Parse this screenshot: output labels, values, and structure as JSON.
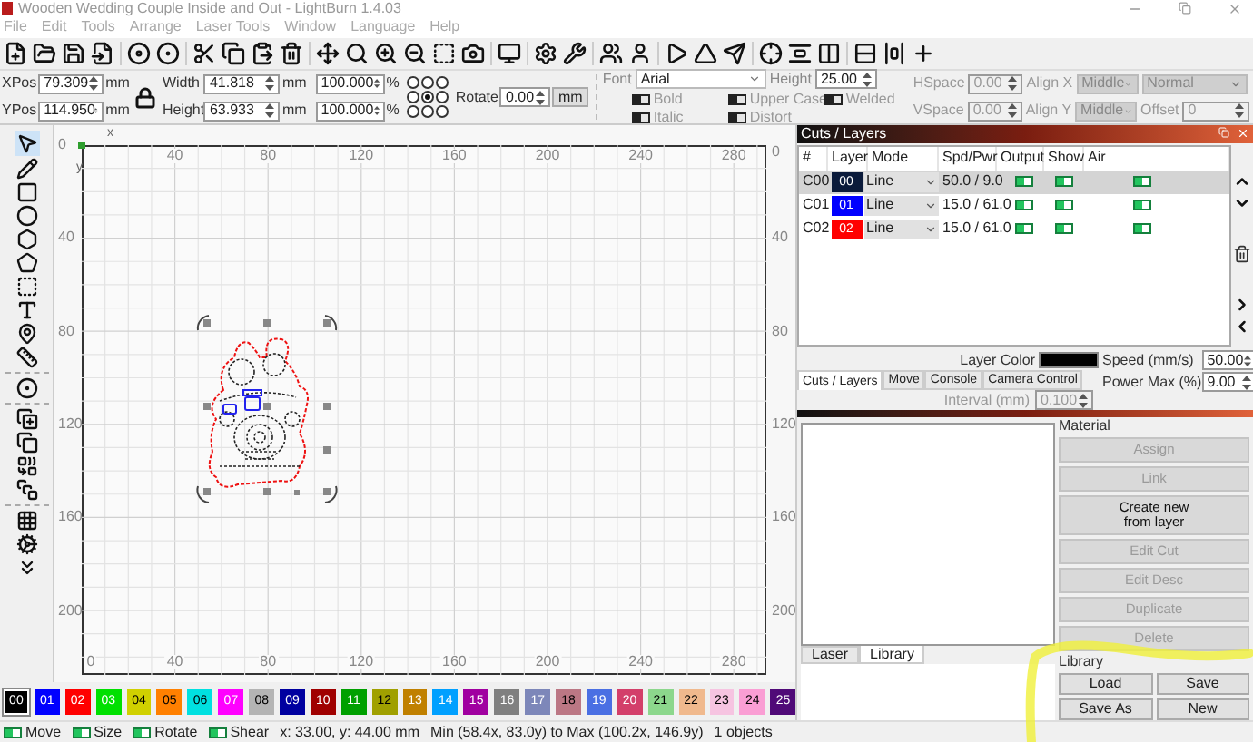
{
  "window": {
    "title": "Wooden Wedding Couple Inside and Out - LightBurn 1.4.03"
  },
  "menu": [
    "File",
    "Edit",
    "Tools",
    "Arrange",
    "Laser Tools",
    "Window",
    "Language",
    "Help"
  ],
  "position": {
    "xpos": {
      "label": "XPos",
      "value": "79.309",
      "unit": "mm"
    },
    "ypos": {
      "label": "YPos",
      "value": "114.950",
      "unit": "mm"
    }
  },
  "size": {
    "width": {
      "label": "Width",
      "value": "41.818",
      "unit": "mm",
      "scale": "100.000",
      "scale_unit": "%"
    },
    "height": {
      "label": "Height",
      "value": "63.933",
      "unit": "mm",
      "scale": "100.000",
      "scale_unit": "%"
    }
  },
  "anchor_points": [
    {
      "selected": false
    },
    {
      "selected": false
    },
    {
      "selected": false
    },
    {
      "selected": false
    },
    {
      "selected": true
    },
    {
      "selected": false
    },
    {
      "selected": false
    },
    {
      "selected": false
    },
    {
      "selected": false
    }
  ],
  "rotate": {
    "label": "Rotate",
    "value": "0.00",
    "unit_button": "mm"
  },
  "text_options": {
    "font": {
      "label": "Font",
      "value": "Arial"
    },
    "height": {
      "label": "Height",
      "value": "25.00"
    },
    "toggles": [
      {
        "label": "Bold",
        "on": false
      },
      {
        "label": "Upper Case",
        "on": false
      },
      {
        "label": "Welded",
        "on": false
      },
      {
        "label": "Italic",
        "on": false
      },
      {
        "label": "Distort",
        "on": false
      }
    ],
    "hspace": {
      "label": "HSpace",
      "value": "0.00"
    },
    "vspace": {
      "label": "VSpace",
      "value": "0.00"
    },
    "align_x": {
      "label": "Align X",
      "value": "Middle"
    },
    "align_y": {
      "label": "Align Y",
      "value": "Middle"
    },
    "mode": {
      "value": "Normal"
    },
    "offset": {
      "label": "Offset",
      "value": "0"
    }
  },
  "canvas": {
    "x_axis_label": "x",
    "y_axis_label": "y",
    "top_ticks": [
      "40",
      "80",
      "120",
      "160",
      "200",
      "240",
      "280"
    ],
    "left_ticks": [
      "0",
      "40",
      "80",
      "120",
      "160",
      "200"
    ],
    "right_ticks": [
      "0",
      "40",
      "80",
      "120",
      "160",
      "200"
    ],
    "bottom_ticks": [
      "0",
      "40",
      "80",
      "120",
      "160",
      "200",
      "240",
      "280"
    ]
  },
  "cuts_layers": {
    "title": "Cuts / Layers",
    "columns": [
      "#",
      "Layer",
      "Mode",
      "Spd/Pwr",
      "Output",
      "Show",
      "Air"
    ],
    "rows": [
      {
        "id": "C00",
        "layer": "00",
        "color": "#0a1a3a",
        "mode": "Line",
        "spd_pwr": "50.0 / 9.0",
        "output": true,
        "show": true,
        "air": true,
        "selected": true
      },
      {
        "id": "C01",
        "layer": "01",
        "color": "#0000ff",
        "mode": "Line",
        "spd_pwr": "15.0 / 61.0",
        "output": true,
        "show": true,
        "air": true,
        "selected": false
      },
      {
        "id": "C02",
        "layer": "02",
        "color": "#ff0000",
        "mode": "Line",
        "spd_pwr": "15.0 / 61.0",
        "output": true,
        "show": true,
        "air": true,
        "selected": false
      }
    ],
    "layer_color": {
      "label": "Layer Color",
      "color": "#000000"
    },
    "speed": {
      "label": "Speed (mm/s)",
      "value": "50.00"
    },
    "power_max": {
      "label": "Power Max (%)",
      "value": "9.00"
    },
    "tabs": [
      {
        "label": "Cuts / Layers",
        "selected": true
      },
      {
        "label": "Move",
        "selected": false
      },
      {
        "label": "Console",
        "selected": false
      },
      {
        "label": "Camera Control",
        "selected": false
      }
    ],
    "interval": {
      "label": "Interval (mm)",
      "value": "0.100",
      "disabled": true
    }
  },
  "material": {
    "title": "Material",
    "buttons": [
      {
        "label": "Assign",
        "disabled": true
      },
      {
        "label": "Link",
        "disabled": true
      },
      {
        "label": "Create new\nfrom layer",
        "disabled": false
      },
      {
        "label": "Edit Cut",
        "disabled": true
      },
      {
        "label": "Edit Desc",
        "disabled": true
      },
      {
        "label": "Duplicate",
        "disabled": true
      },
      {
        "label": "Delete",
        "disabled": true
      }
    ],
    "library_title": "Library",
    "library_buttons": [
      "Load",
      "Save",
      "Save As",
      "New"
    ],
    "tabs": [
      {
        "label": "Laser",
        "selected": false
      },
      {
        "label": "Library",
        "selected": true
      }
    ]
  },
  "palette": [
    {
      "label": "00",
      "color": "#000000",
      "selected": true
    },
    {
      "label": "01",
      "color": "#0000ff",
      "selected": false
    },
    {
      "label": "02",
      "color": "#ff0000",
      "selected": false
    },
    {
      "label": "03",
      "color": "#00e000",
      "selected": false
    },
    {
      "label": "04",
      "color": "#d0d000",
      "selected": false
    },
    {
      "label": "05",
      "color": "#ff8000",
      "selected": false
    },
    {
      "label": "06",
      "color": "#00e0e0",
      "selected": false
    },
    {
      "label": "07",
      "color": "#ff00ff",
      "selected": false
    },
    {
      "label": "08",
      "color": "#b4b4b4",
      "selected": false
    },
    {
      "label": "09",
      "color": "#0000a0",
      "selected": false
    },
    {
      "label": "10",
      "color": "#a00000",
      "selected": false
    },
    {
      "label": "11",
      "color": "#00a000",
      "selected": false
    },
    {
      "label": "12",
      "color": "#a0a000",
      "selected": false
    },
    {
      "label": "13",
      "color": "#c08000",
      "selected": false
    },
    {
      "label": "14",
      "color": "#00a0ff",
      "selected": false
    },
    {
      "label": "15",
      "color": "#a000a0",
      "selected": false
    },
    {
      "label": "16",
      "color": "#808080",
      "selected": false
    },
    {
      "label": "17",
      "color": "#7d87b9",
      "selected": false
    },
    {
      "label": "18",
      "color": "#bb7784",
      "selected": false
    },
    {
      "label": "19",
      "color": "#4a6fe3",
      "selected": false
    },
    {
      "label": "20",
      "color": "#d33f6a",
      "selected": false
    },
    {
      "label": "21",
      "color": "#8cd78c",
      "selected": false
    },
    {
      "label": "22",
      "color": "#f0b98d",
      "selected": false
    },
    {
      "label": "23",
      "color": "#f6c4e1",
      "selected": false
    },
    {
      "label": "24",
      "color": "#fa9ed4",
      "selected": false
    },
    {
      "label": "25",
      "color": "#500a78",
      "selected": false
    }
  ],
  "status_bar": {
    "toggles": [
      {
        "label": "Move",
        "on": true
      },
      {
        "label": "Size",
        "on": true
      },
      {
        "label": "Rotate",
        "on": true
      },
      {
        "label": "Shear",
        "on": true
      }
    ],
    "cursor": "x: 33.00, y: 44.00 mm",
    "bounds": "Min (58.4x, 83.0y) to Max (100.2x, 146.9y)",
    "objects": "1 objects"
  }
}
